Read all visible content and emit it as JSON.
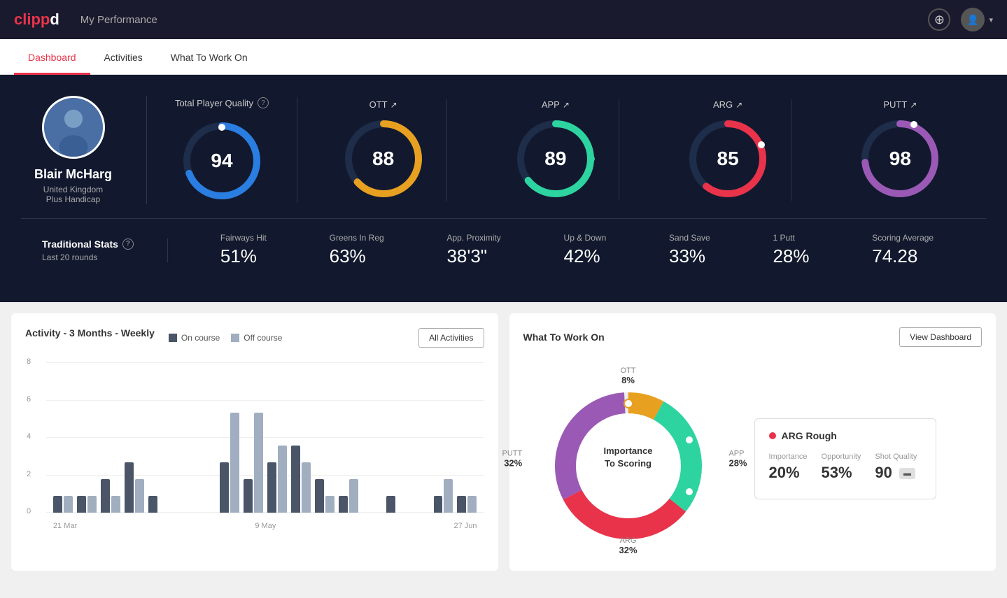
{
  "header": {
    "logo_clip": "clipp",
    "logo_pd": "d",
    "title": "My Performance",
    "add_label": "+",
    "avatar_label": "▾"
  },
  "tabs": [
    {
      "id": "dashboard",
      "label": "Dashboard",
      "active": true
    },
    {
      "id": "activities",
      "label": "Activities",
      "active": false
    },
    {
      "id": "what-to-work-on",
      "label": "What To Work On",
      "active": false
    }
  ],
  "player": {
    "name": "Blair McHarg",
    "country": "United Kingdom",
    "handicap": "Plus Handicap"
  },
  "quality": {
    "main_label": "Total Player Quality",
    "main_score": 94,
    "main_color": "#2a7de1",
    "items": [
      {
        "id": "ott",
        "label": "OTT",
        "score": 88,
        "color": "#e8a020"
      },
      {
        "id": "app",
        "label": "APP",
        "score": 89,
        "color": "#2dd4a0"
      },
      {
        "id": "arg",
        "label": "ARG",
        "score": 85,
        "color": "#e8334a"
      },
      {
        "id": "putt",
        "label": "PUTT",
        "score": 98,
        "color": "#9b59b6"
      }
    ]
  },
  "stats": {
    "label": "Traditional Stats",
    "sublabel": "Last 20 rounds",
    "items": [
      {
        "name": "Fairways Hit",
        "value": "51%"
      },
      {
        "name": "Greens In Reg",
        "value": "63%"
      },
      {
        "name": "App. Proximity",
        "value": "38'3\""
      },
      {
        "name": "Up & Down",
        "value": "42%"
      },
      {
        "name": "Sand Save",
        "value": "33%"
      },
      {
        "name": "1 Putt",
        "value": "28%"
      },
      {
        "name": "Scoring Average",
        "value": "74.28"
      }
    ]
  },
  "activity": {
    "title": "Activity - 3 Months - Weekly",
    "legend_oncourse": "On course",
    "legend_offcourse": "Off course",
    "button": "All Activities",
    "y_labels": [
      "8",
      "6",
      "4",
      "2",
      "0"
    ],
    "x_labels": [
      "21 Mar",
      "9 May",
      "27 Jun"
    ],
    "bars": [
      {
        "on": 1,
        "off": 1
      },
      {
        "on": 1,
        "off": 1
      },
      {
        "on": 2,
        "off": 1
      },
      {
        "on": 3,
        "off": 2
      },
      {
        "on": 1,
        "off": 0
      },
      {
        "on": 0,
        "off": 0
      },
      {
        "on": 0,
        "off": 0
      },
      {
        "on": 3,
        "off": 6
      },
      {
        "on": 2,
        "off": 6
      },
      {
        "on": 3,
        "off": 4
      },
      {
        "on": 4,
        "off": 3
      },
      {
        "on": 2,
        "off": 1
      },
      {
        "on": 1,
        "off": 2
      },
      {
        "on": 0,
        "off": 0
      },
      {
        "on": 1,
        "off": 0
      },
      {
        "on": 0,
        "off": 0
      },
      {
        "on": 1,
        "off": 2
      },
      {
        "on": 1,
        "off": 1
      }
    ]
  },
  "what_to_work_on": {
    "title": "What To Work On",
    "button": "View Dashboard",
    "center_text": "Importance\nTo Scoring",
    "segments": [
      {
        "id": "ott",
        "label": "OTT",
        "value": "8%",
        "color": "#e8a020",
        "position": "top"
      },
      {
        "id": "app",
        "label": "APP",
        "value": "28%",
        "color": "#2dd4a0",
        "position": "right"
      },
      {
        "id": "arg",
        "label": "ARG",
        "value": "32%",
        "color": "#e8334a",
        "position": "bottom"
      },
      {
        "id": "putt",
        "label": "PUTT",
        "value": "32%",
        "color": "#9b59b6",
        "position": "left"
      }
    ],
    "card": {
      "title": "ARG Rough",
      "dot_color": "#e8334a",
      "metrics": [
        {
          "label": "Importance",
          "value": "20%"
        },
        {
          "label": "Opportunity",
          "value": "53%"
        },
        {
          "label": "Shot Quality",
          "value": "90",
          "badge": "▬"
        }
      ]
    }
  }
}
